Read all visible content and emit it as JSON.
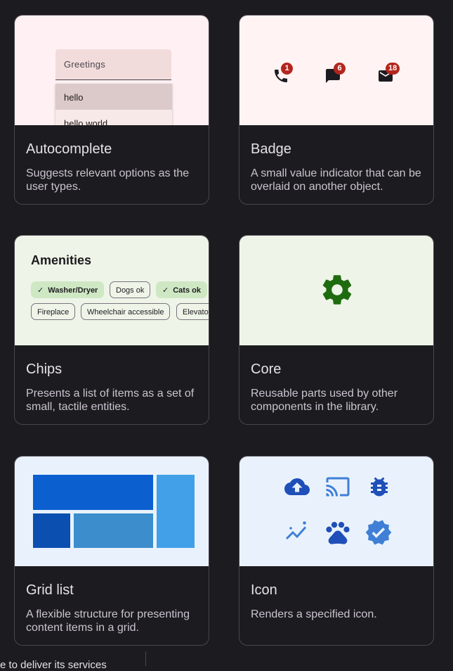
{
  "cards": {
    "autocomplete": {
      "title": "Autocomplete",
      "description": "Suggests relevant options as the user types.",
      "field_label": "Greetings",
      "options": [
        "hello",
        "hello world"
      ],
      "preview_bg": "#fff0f3"
    },
    "badge": {
      "title": "Badge",
      "description": "A small value indicator that can be overlaid on another object.",
      "badges": [
        {
          "icon": "phone-icon",
          "count": "1"
        },
        {
          "icon": "chat-icon",
          "count": "6"
        },
        {
          "icon": "mail-icon",
          "count": "18"
        }
      ],
      "preview_bg": "#fff3f3"
    },
    "chips": {
      "title": "Chips",
      "description": "Presents a list of items as a set of small, tactile entities.",
      "heading": "Amenities",
      "row1": [
        "Washer/Dryer",
        "Dogs ok",
        "Cats ok"
      ],
      "row2": [
        "Fireplace",
        "Wheelchair accessible",
        "Elevator"
      ],
      "preview_bg": "#eef5e8"
    },
    "core": {
      "title": "Core",
      "description": "Reusable parts used by other components in the library.",
      "icon": "gear-icon",
      "preview_bg": "#eef5e8"
    },
    "grid_list": {
      "title": "Grid list",
      "description": "A flexible structure for presenting content items in a grid.",
      "preview_bg": "#e9f2fc"
    },
    "icon": {
      "title": "Icon",
      "description": "Renders a specified icon.",
      "icons": [
        "cloud-upload-icon",
        "cast-icon",
        "bug-icon",
        "analytics-icon",
        "paw-icon",
        "verified-icon"
      ],
      "preview_bg": "#e9f2fc"
    }
  },
  "footer": {
    "text": "e to deliver its services"
  },
  "colors": {
    "background": "#1c1b1f",
    "badge": "#b3261e",
    "core_gear": "#1f6b0f",
    "grid_dark": "#0b5fcf",
    "icon_blue": "#1f4fb8"
  }
}
